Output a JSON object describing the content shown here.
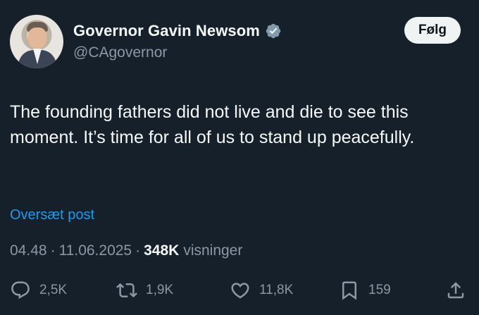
{
  "author": {
    "display_name": "Governor Gavin Newsom",
    "handle": "@CAgovernor",
    "verified_badge_icon": "verified-badge-icon",
    "verified_color": "#829aab"
  },
  "follow_button": {
    "label": "Følg"
  },
  "post": {
    "text": "The founding fathers did not live and die to see this moment. It’s time for all of us to stand up peacefully."
  },
  "translate_link": {
    "label": "Oversæt post"
  },
  "meta": {
    "time": "04.48",
    "separator": "·",
    "date": "11.06.2025",
    "views_count": "348K",
    "views_label": "visninger"
  },
  "actions": {
    "reply": {
      "icon": "reply-icon",
      "count": "2,5K"
    },
    "repost": {
      "icon": "repost-icon",
      "count": "1,9K"
    },
    "like": {
      "icon": "heart-icon",
      "count": "11,8K"
    },
    "bookmark": {
      "icon": "bookmark-icon",
      "count": "159"
    },
    "share": {
      "icon": "share-icon"
    }
  },
  "colors": {
    "background": "#15202b",
    "primary_text": "#f7f9f9",
    "secondary_text": "#8b98a5",
    "link": "#1d9bf0",
    "button_bg": "#eff3f4"
  }
}
